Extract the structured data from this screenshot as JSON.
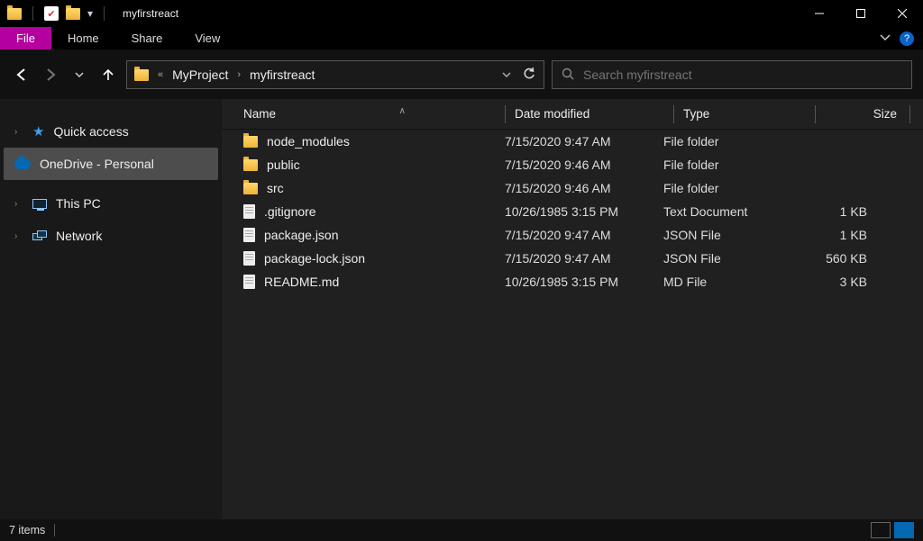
{
  "window": {
    "title": "myfirstreact"
  },
  "ribbon": {
    "file": "File",
    "tabs": [
      "Home",
      "Share",
      "View"
    ]
  },
  "address": {
    "crumbs": [
      "MyProject",
      "myfirstreact"
    ]
  },
  "search": {
    "placeholder": "Search myfirstreact"
  },
  "sidebar": {
    "items": [
      {
        "label": "Quick access",
        "icon": "star",
        "expandable": true,
        "selected": false
      },
      {
        "label": "OneDrive - Personal",
        "icon": "cloud",
        "expandable": false,
        "selected": true
      },
      {
        "label": "This PC",
        "icon": "pc",
        "expandable": true,
        "selected": false
      },
      {
        "label": "Network",
        "icon": "net",
        "expandable": true,
        "selected": false
      }
    ]
  },
  "columns": {
    "name": "Name",
    "date": "Date modified",
    "type": "Type",
    "size": "Size"
  },
  "files": [
    {
      "name": "node_modules",
      "date": "7/15/2020 9:47 AM",
      "type": "File folder",
      "size": "",
      "icon": "folder"
    },
    {
      "name": "public",
      "date": "7/15/2020 9:46 AM",
      "type": "File folder",
      "size": "",
      "icon": "folder"
    },
    {
      "name": "src",
      "date": "7/15/2020 9:46 AM",
      "type": "File folder",
      "size": "",
      "icon": "folder"
    },
    {
      "name": ".gitignore",
      "date": "10/26/1985 3:15 PM",
      "type": "Text Document",
      "size": "1 KB",
      "icon": "file"
    },
    {
      "name": "package.json",
      "date": "7/15/2020 9:47 AM",
      "type": "JSON File",
      "size": "1 KB",
      "icon": "file"
    },
    {
      "name": "package-lock.json",
      "date": "7/15/2020 9:47 AM",
      "type": "JSON File",
      "size": "560 KB",
      "icon": "file"
    },
    {
      "name": "README.md",
      "date": "10/26/1985 3:15 PM",
      "type": "MD File",
      "size": "3 KB",
      "icon": "file"
    }
  ],
  "status": {
    "count": "7 items"
  }
}
